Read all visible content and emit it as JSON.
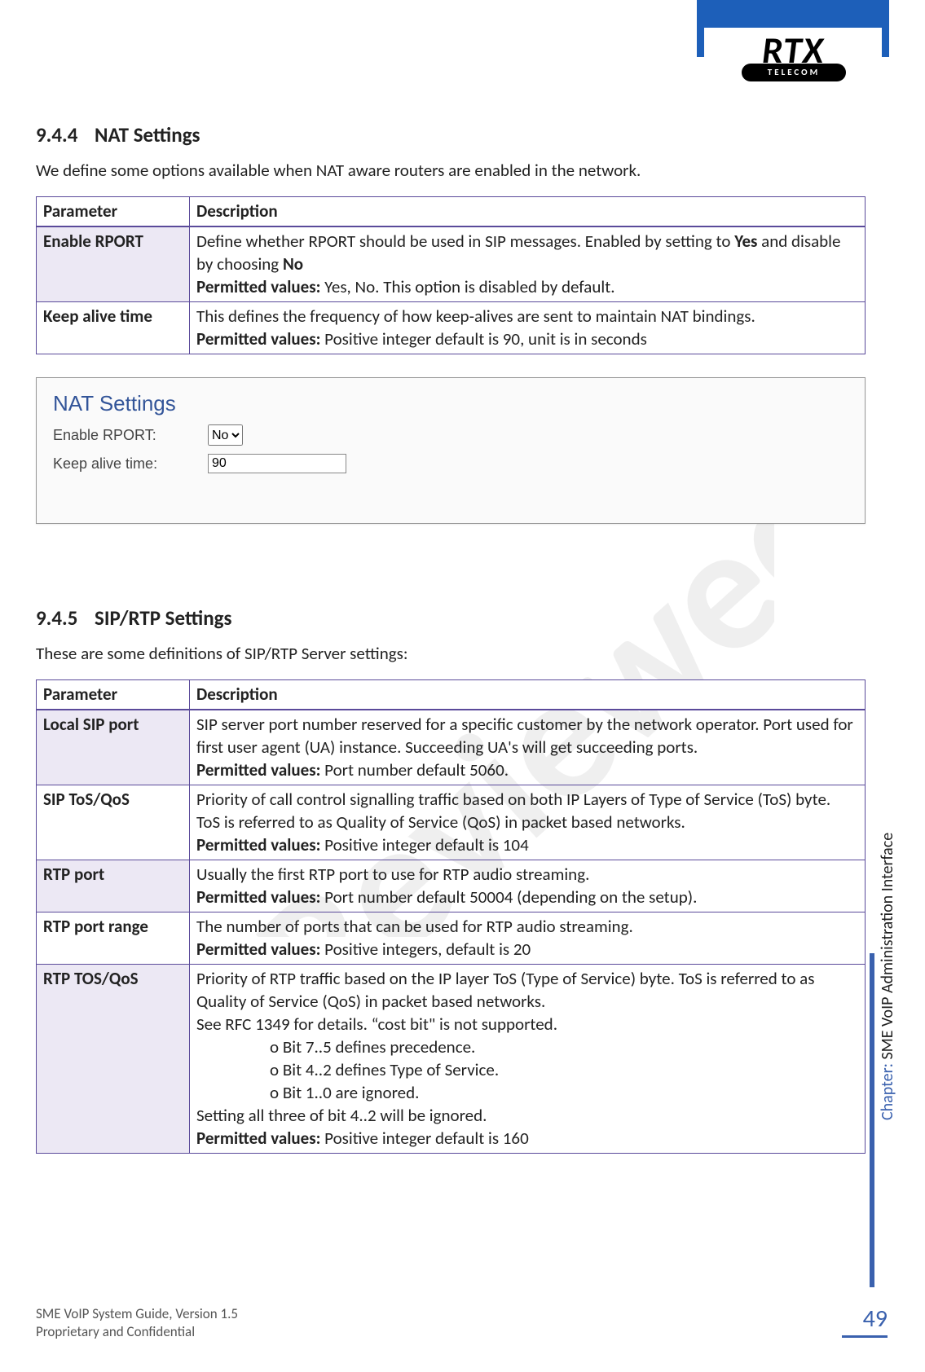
{
  "logo": {
    "brand": "RTX",
    "sub": "TELECOM"
  },
  "section1": {
    "num": "9.4.4",
    "title": "NAT Settings",
    "intro": "We define some options available when NAT aware routers are enabled in the network.",
    "head_param": "Parameter",
    "head_desc": "Description",
    "rows": [
      {
        "name": "Enable RPORT",
        "desc_a": "Define whether RPORT should be used in SIP messages. Enabled by setting to ",
        "desc_b": "Yes",
        "desc_c": " and disable by choosing ",
        "desc_d": "No",
        "pv_label": "Permitted values:",
        "pv_text": " Yes, No. This option is disabled by default."
      },
      {
        "name": "Keep alive time",
        "desc_a": "This defines the frequency of how keep-alives are sent to maintain NAT bindings.",
        "pv_label": "Permitted values:",
        "pv_text": " Positive integer default is 90, unit is in seconds"
      }
    ]
  },
  "nat_figure": {
    "title": "NAT Settings",
    "row1_label": "Enable RPORT:",
    "row1_value": "No",
    "row2_label": "Keep alive time:",
    "row2_value": "90"
  },
  "section2": {
    "num": "9.4.5",
    "title": "SIP/RTP Settings",
    "intro": "These are some definitions of SIP/RTP Server settings:",
    "head_param": "Parameter",
    "head_desc": "Description",
    "rows": [
      {
        "name": "Local SIP port",
        "desc": "SIP server port number reserved for a specific customer by the network operator. Port used for first user agent (UA) instance. Succeeding UA's will get succeeding ports.",
        "pv_label": "Permitted values:",
        "pv_text": " Port number default 5060."
      },
      {
        "name": "SIP ToS/QoS",
        "desc": "Priority of call control signalling traffic based on both IP Layers of Type of Service (ToS) byte. ToS is referred to as Quality of Service (QoS) in packet based networks.",
        "pv_label": "Permitted values:",
        "pv_text": " Positive integer default is 104"
      },
      {
        "name": "RTP port",
        "desc": "Usually the first RTP port to use for RTP audio streaming.",
        "pv_label": "Permitted values:",
        "pv_text": " Port number default 50004 (depending on the setup)."
      },
      {
        "name": "RTP port range",
        "desc": "The number of ports that can be used for RTP audio streaming.",
        "pv_label": "Permitted values:",
        "pv_text": " Positive integers, default is 20"
      },
      {
        "name": "RTP TOS/QoS",
        "desc_line1": "Priority of RTP traffic based on the IP layer ToS (Type of Service) byte. ToS is referred to as Quality of Service (QoS) in packet based networks.",
        "desc_line2": "See RFC 1349 for details. “cost bit\" is not supported.",
        "bul1": "o Bit 7..5 defines precedence.",
        "bul2": "o Bit 4..2 defines Type of Service.",
        "bul3": "o Bit 1..0 are ignored.",
        "desc_line3": "Setting all three of bit 4..2 will be ignored.",
        "pv_label": "Permitted values:",
        "pv_text": " Positive integer default is 160"
      }
    ]
  },
  "chapter": {
    "label": "Chapter:",
    "value": " SME VoIP Administration Interface"
  },
  "footer": {
    "line1": "SME VoIP System Guide, Version 1.5",
    "line2": "Proprietary and Confidential",
    "page": "49"
  },
  "watermark": "Reviewed"
}
